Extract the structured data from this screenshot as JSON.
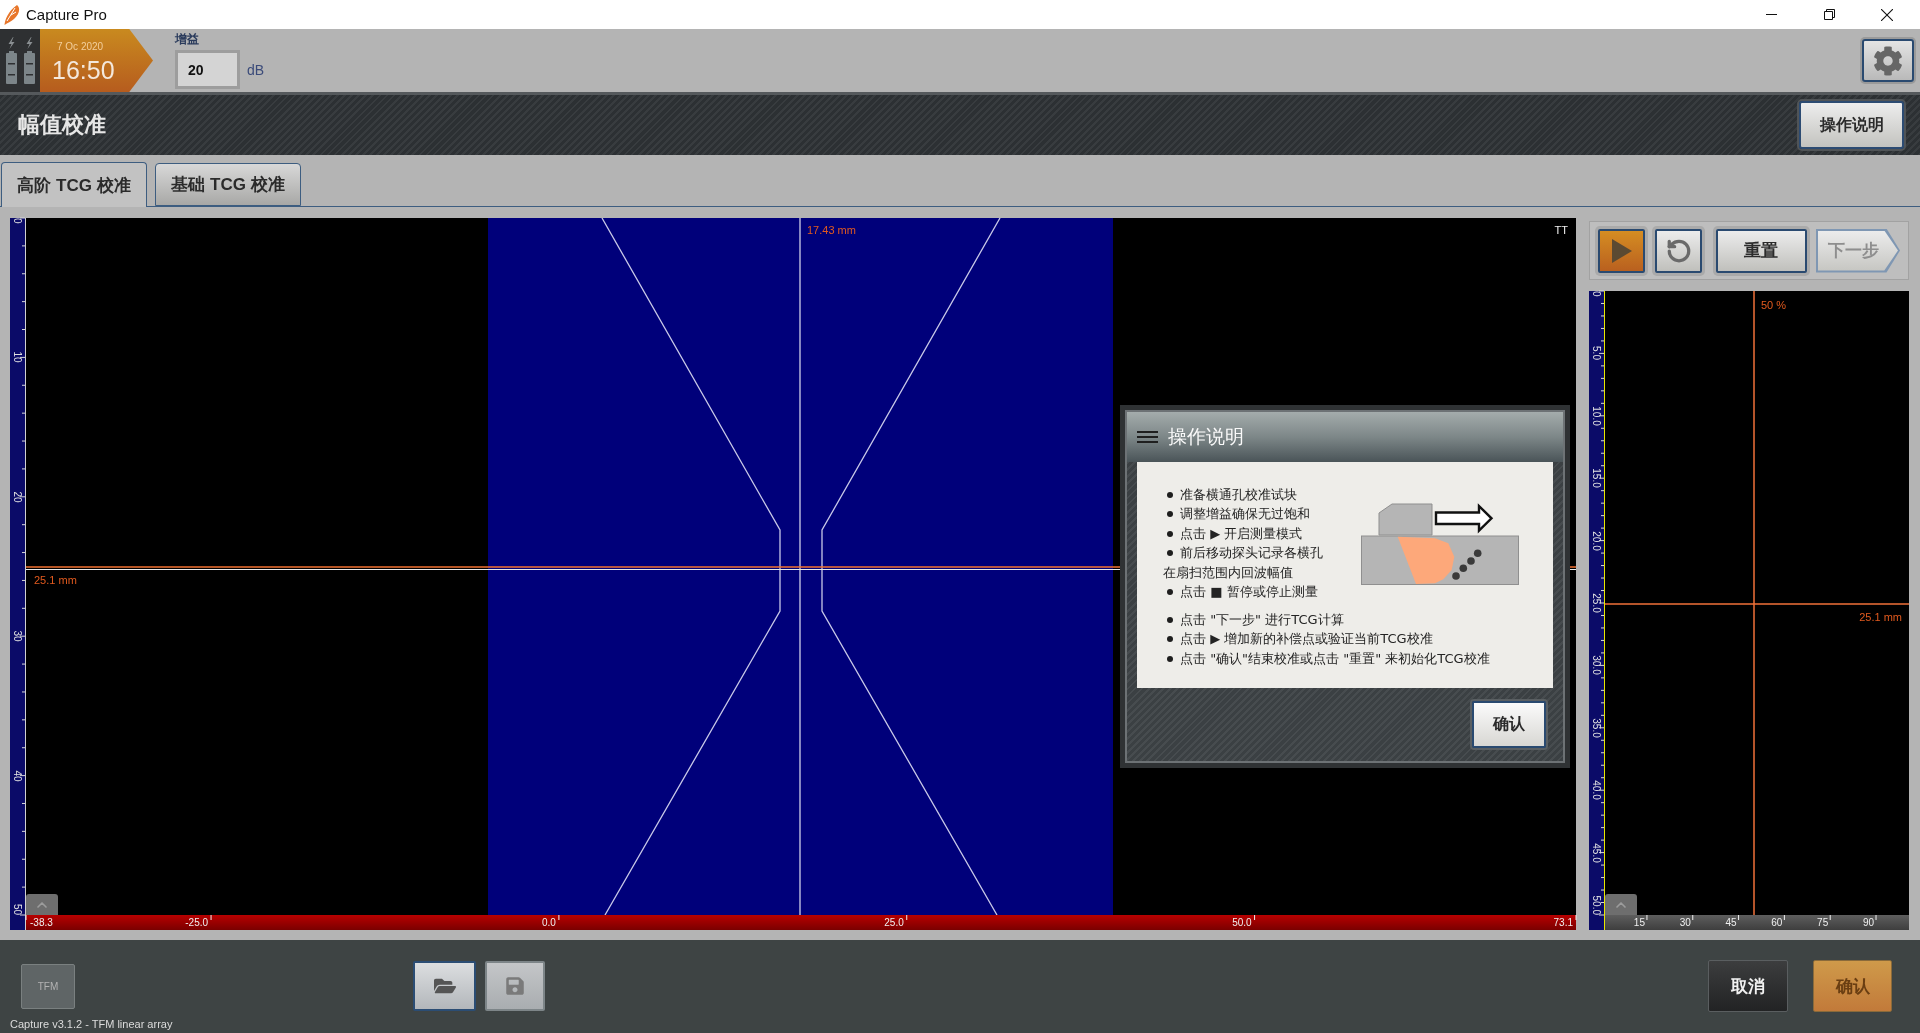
{
  "window": {
    "title": "Capture Pro"
  },
  "toolbar": {
    "date": "7 Oc 2020",
    "time": "16:50",
    "gain": {
      "label": "增益",
      "value": "20",
      "unit": "dB"
    }
  },
  "header": {
    "title": "幅值校准",
    "help_button": "操作说明"
  },
  "tabs": [
    {
      "label": "高阶 TCG 校准",
      "selected": true
    },
    {
      "label": "基础 TCG 校准",
      "selected": false
    }
  ],
  "scan_view": {
    "depth_ticks": [
      "0",
      "10",
      "20",
      "30",
      "40",
      "50"
    ],
    "position_ticks": [
      "-38.3",
      "-25.0",
      "0.0",
      "25.0",
      "50.0",
      "73.1"
    ],
    "index_cursor": "17.43 mm",
    "depth_cursor": "25.1 mm",
    "corner_label": "TT"
  },
  "scan_controls": [
    {
      "kind": "play",
      "disabled": false
    },
    {
      "kind": "reset",
      "disabled": false
    },
    {
      "kind": "text",
      "label": "重置",
      "disabled": false
    },
    {
      "kind": "next",
      "label": "下一步",
      "disabled": true
    }
  ],
  "ascan_view": {
    "depth_ticks": [
      "0",
      "5.0",
      "10.0",
      "15.0",
      "20.0",
      "25.0",
      "30.0",
      "35.0",
      "40.0",
      "45.0",
      "50.0"
    ],
    "angle_ticks": [
      "15",
      "30",
      "45",
      "60",
      "75",
      "90"
    ],
    "amplitude_cursor": "50 %",
    "depth_cursor": "25.1 mm"
  },
  "dialog": {
    "title": "操作说明",
    "step_groups": [
      [
        {
          "kind": "bullet",
          "text": "准备横通孔校准试块"
        },
        {
          "kind": "bullet",
          "text": "调整增益确保无过饱和"
        },
        {
          "kind": "bullet",
          "text": "点击 ▶ 开启测量模式"
        },
        {
          "kind": "bullet",
          "text": "前后移动探头记录各横孔"
        },
        {
          "kind": "continuation",
          "text": "在扇扫范围内回波幅值"
        },
        {
          "kind": "bullet",
          "text": "点击 ■ 暂停或停止测量"
        }
      ],
      [
        {
          "kind": "bullet",
          "text": "点击 \"下一步\" 进行TCG计算"
        },
        {
          "kind": "bullet",
          "text": "点击 ▶ 增加新的补偿点或验证当前TCG校准"
        },
        {
          "kind": "bullet",
          "text": "点击 \"确认\"结束校准或点击 \"重置\" 来初始化TCG校准"
        }
      ]
    ],
    "confirm": "确认"
  },
  "footer": {
    "mode_button": "TFM",
    "file_buttons": [
      {
        "kind": "open",
        "disabled": false
      },
      {
        "kind": "save",
        "disabled": true
      }
    ],
    "cancel": "取消",
    "confirm": {
      "label": "确认",
      "disabled": true
    },
    "status": "Capture v3.1.2 - TFM linear array"
  }
}
